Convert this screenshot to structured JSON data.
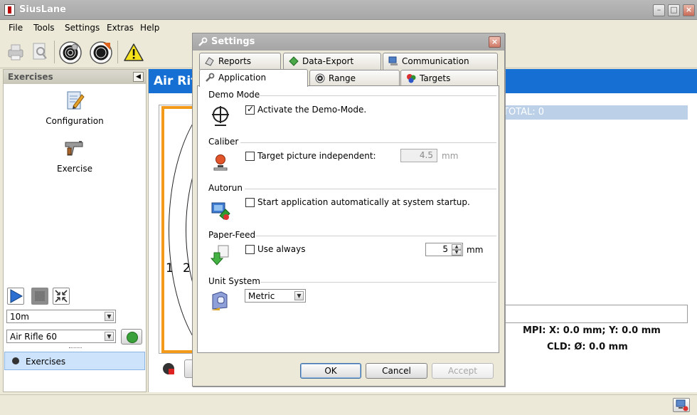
{
  "app": {
    "title": "SiusLane"
  },
  "menu": [
    "File",
    "Tools",
    "Settings",
    "Extras",
    "Help"
  ],
  "toolbar": {
    "buttons": [
      "printer-icon",
      "print-preview-icon",
      "target-icon",
      "target-shot-icon",
      "warning-icon"
    ]
  },
  "left_panel": {
    "title": "Exercises",
    "nav": [
      {
        "label": "Configuration",
        "icon": "notepad-pencil-icon"
      },
      {
        "label": "Exercise",
        "icon": "air-pistol-icon"
      }
    ],
    "distance": "10m",
    "program": "Air Rifle 60",
    "bottom_tab": "Exercises"
  },
  "content": {
    "banner_title": "Air Rifle",
    "score_total": "TOTAL:  0",
    "ring_numbers": [
      "1",
      "2"
    ],
    "mpi": "MPI:   X: 0.0 mm; Y: 0.0 mm",
    "cld": "CLD:   Ø: 0.0 mm"
  },
  "dialog": {
    "title": "Settings",
    "tabs_row1": [
      {
        "label": "Reports",
        "icon": "reports-icon"
      },
      {
        "label": "Data-Export",
        "icon": "data-export-icon"
      },
      {
        "label": "Communication",
        "icon": "communication-icon"
      }
    ],
    "tabs_row2": [
      {
        "label": "Application",
        "icon": "wrench-icon",
        "active": true
      },
      {
        "label": "Range",
        "icon": "range-icon"
      },
      {
        "label": "Targets",
        "icon": "targets-icon"
      }
    ],
    "sections": {
      "demo": {
        "title": "Demo Mode",
        "option": "Activate the Demo-Mode.",
        "checked": true
      },
      "caliber": {
        "title": "Caliber",
        "option": "Target picture independent:",
        "checked": false,
        "value": "4.5",
        "unit": "mm"
      },
      "autorun": {
        "title": "Autorun",
        "option": "Start application automatically at system startup.",
        "checked": false
      },
      "paper": {
        "title": "Paper-Feed",
        "option": "Use always",
        "checked": false,
        "value": "5",
        "unit": "mm"
      },
      "unit": {
        "title": "Unit System",
        "value": "Metric"
      }
    },
    "buttons": {
      "ok": "OK",
      "cancel": "Cancel",
      "accept": "Accept"
    }
  }
}
